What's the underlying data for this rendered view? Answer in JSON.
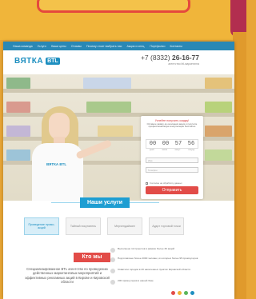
{
  "navbar": {
    "items": [
      "Наша команда",
      "Услуги",
      "Наши цены",
      "Отзывы",
      "Почему стоит выбрать нас",
      "Акции и спец.",
      "Портфолио",
      "Контакты"
    ]
  },
  "header": {
    "logo_text": "ВЯТКА",
    "logo_box": "BTL",
    "phone_prefix": "+7 (8332)",
    "phone_number": "26-16-77",
    "tagline": "агентство btl-маркетинга"
  },
  "form": {
    "title": "Успейте получить скидку!",
    "subtitle": "Оставьте заявку до окончания акции и получите профессиональную консультацию бесплатно",
    "timer": [
      "00",
      "00",
      "57",
      "56"
    ],
    "timer_labels": [
      "дней",
      "часов",
      "минут",
      "секунд"
    ],
    "name_placeholder": "Имя",
    "phone_placeholder": "Телефон",
    "check_label": "Согласен на обработку данных",
    "submit_label": "Отправить"
  },
  "services": {
    "title": "Наши услуги",
    "items": [
      "Проведение промо-акций",
      "Тайный покупатель",
      "Мерчендайзинг",
      "Аудит торговой точки"
    ]
  },
  "about": {
    "title": "Кто мы",
    "text": "Специализированное BTL агентство по проведению действенных маркетинговых мероприятий и эффективных рекламных акций в Кирове и Кировской области",
    "facts": [
      "Выполнено 12 проектов в рамках более 30 акций",
      "Подготовлено более 2000 человек, из которых более 95 промоутеров",
      "Охватили городов в 20 населенных пунктах Кировской области",
      "200 промоутеров в нашей базе"
    ]
  },
  "colors": {
    "brand_blue": "#1e8fc0",
    "accent_red": "#e24c48",
    "orange_bg": "#e8a636"
  }
}
